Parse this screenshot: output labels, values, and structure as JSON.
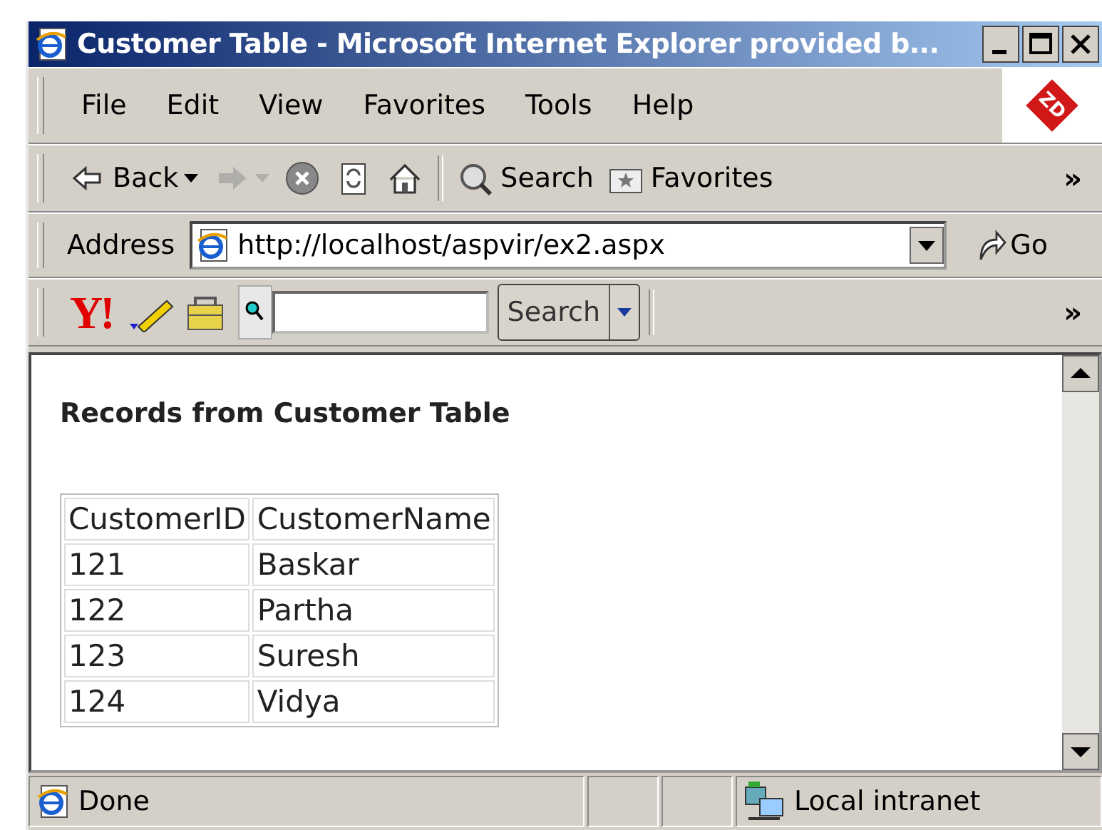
{
  "window": {
    "title": "Customer Table - Microsoft Internet Explorer provided b..."
  },
  "menu": [
    "File",
    "Edit",
    "View",
    "Favorites",
    "Tools",
    "Help"
  ],
  "brand_logo": "ZD",
  "toolbar": [
    {
      "kind": "back",
      "label": "Back",
      "disabled": false
    },
    {
      "kind": "forward",
      "disabled": true
    },
    {
      "kind": "stop",
      "disabled": false
    },
    {
      "kind": "refresh",
      "disabled": false
    },
    {
      "kind": "home",
      "disabled": false
    },
    {
      "kind": "search",
      "label": "Search",
      "disabled": false
    },
    {
      "kind": "favorites",
      "label": "Favorites",
      "disabled": false
    }
  ],
  "toolbar_more": "»",
  "address": {
    "label": "Address",
    "value": "http://localhost/aspvir/ex2.aspx",
    "go": "Go"
  },
  "yahoo_toolbar": {
    "logo": "Y!",
    "search_button": "Search",
    "more": "»"
  },
  "page": {
    "heading": "Records from Customer Table",
    "table": {
      "columns": [
        "CustomerID",
        "CustomerName"
      ],
      "rows": [
        [
          "121",
          "Baskar"
        ],
        [
          "122",
          "Partha"
        ],
        [
          "123",
          "Suresh"
        ],
        [
          "124",
          "Vidya"
        ]
      ]
    }
  },
  "status_bar": {
    "text": "Done",
    "zone": "Local intranet"
  }
}
